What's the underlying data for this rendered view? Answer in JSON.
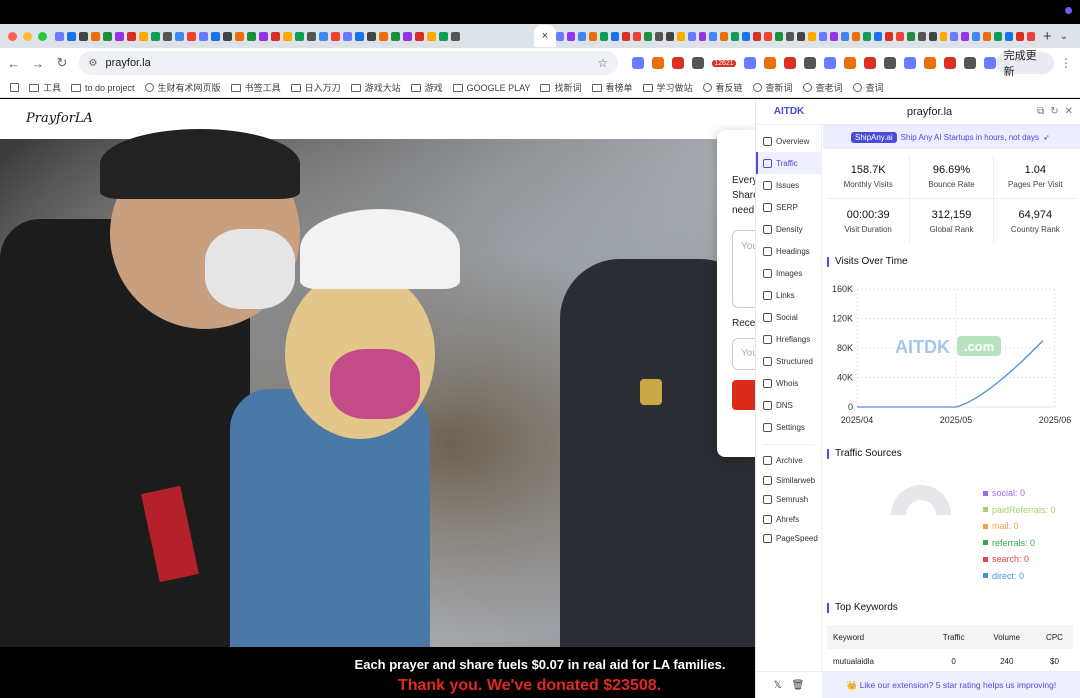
{
  "browser": {
    "active_tab_close": "×",
    "new_tab": "+",
    "tab_menu": "⌄",
    "url": "prayfor.la",
    "update_button": "完成更新",
    "bookmarks": [
      {
        "icon": "apps-icon",
        "label": ""
      },
      {
        "icon": "folder-icon",
        "label": "工具"
      },
      {
        "icon": "folder-icon",
        "label": "to do project"
      },
      {
        "icon": "site-icon",
        "label": "生财有术网页版"
      },
      {
        "icon": "folder-icon",
        "label": "书签工具"
      },
      {
        "icon": "folder-icon",
        "label": "日入万刀"
      },
      {
        "icon": "folder-icon",
        "label": "游戏大站"
      },
      {
        "icon": "folder-icon",
        "label": "游戏"
      },
      {
        "icon": "folder-icon",
        "label": "GOOGLE PLAY"
      },
      {
        "icon": "folder-icon",
        "label": "找新词"
      },
      {
        "icon": "folder-icon",
        "label": "看榜单"
      },
      {
        "icon": "folder-icon",
        "label": "学习做站"
      },
      {
        "icon": "site-icon",
        "label": "看反链"
      },
      {
        "icon": "site-icon",
        "label": "查新词"
      },
      {
        "icon": "site-icon",
        "label": "查老词"
      },
      {
        "icon": "site-icon",
        "label": "查词"
      }
    ],
    "ext_badge": "12621"
  },
  "page": {
    "logo": "PrayforLA",
    "card": {
      "line1": "Every",
      "line2": "Share",
      "line3": "need",
      "textarea_placeholder": "You",
      "label": "Recei",
      "input_placeholder": "You"
    },
    "footer_line1": "Each prayer and share fuels $0.07 in real aid for LA families.",
    "footer_line2": "Thank you. We've donated  $23508."
  },
  "panel": {
    "brand": "AITDK",
    "site": "prayfor.la",
    "nav": [
      {
        "label": "Overview",
        "icon": "overview-icon",
        "active": false
      },
      {
        "label": "Traffic",
        "icon": "traffic-icon",
        "active": true
      },
      {
        "label": "Issues",
        "icon": "warning-icon",
        "active": false
      },
      {
        "label": "SERP",
        "icon": "serp-icon",
        "active": false
      },
      {
        "label": "Density",
        "icon": "density-icon",
        "active": false
      },
      {
        "label": "Headings",
        "icon": "headings-icon",
        "active": false
      },
      {
        "label": "Images",
        "icon": "image-icon",
        "active": false
      },
      {
        "label": "Links",
        "icon": "link-icon",
        "active": false
      },
      {
        "label": "Social",
        "icon": "social-icon",
        "active": false
      },
      {
        "label": "Hreflangs",
        "icon": "globe-icon",
        "active": false
      },
      {
        "label": "Structured",
        "icon": "braces-icon",
        "active": false
      },
      {
        "label": "Whois",
        "icon": "whois-icon",
        "active": false
      },
      {
        "label": "DNS",
        "icon": "dns-icon",
        "active": false
      },
      {
        "label": "Settings",
        "icon": "gear-icon",
        "active": false
      }
    ],
    "external": [
      {
        "label": "Archive",
        "icon": "archive-icon"
      },
      {
        "label": "Similarweb",
        "icon": "similarweb-icon"
      },
      {
        "label": "Semrush",
        "icon": "semrush-icon"
      },
      {
        "label": "Ahrefs",
        "icon": "ahrefs-icon"
      },
      {
        "label": "PageSpeed",
        "icon": "pagespeed-icon"
      }
    ],
    "promo_tag": "ShipAny.ai",
    "promo_text": "Ship Any AI Startups in hours, not days",
    "stats": [
      {
        "value": "158.7K",
        "label": "Monthly Visits"
      },
      {
        "value": "96.69%",
        "label": "Bounce Rate"
      },
      {
        "value": "1.04",
        "label": "Pages Per Visit"
      },
      {
        "value": "00:00:39",
        "label": "Visit Duration"
      },
      {
        "value": "312,159",
        "label": "Global Rank"
      },
      {
        "value": "64,974",
        "label": "Country Rank"
      }
    ],
    "visits_title": "Visits Over Time",
    "sources_title": "Traffic Sources",
    "keywords_title": "Top Keywords",
    "watermark_text": "AITDK",
    "watermark_badge": ".com",
    "sources": [
      {
        "label": "social: 0",
        "color": "#9b6cf0"
      },
      {
        "label": "paidReferrals: 0",
        "color": "#a8d16a"
      },
      {
        "label": "mail: 0",
        "color": "#f0a146"
      },
      {
        "label": "referrals: 0",
        "color": "#3aa748"
      },
      {
        "label": "search: 0",
        "color": "#e64545"
      },
      {
        "label": "direct: 0",
        "color": "#4a90e2"
      }
    ],
    "keywords": {
      "headers": [
        "Keyword",
        "Traffic",
        "Volume",
        "CPC"
      ],
      "rows": [
        [
          "mutualaidla",
          "0",
          "240",
          "$0"
        ]
      ]
    },
    "footer_rating": "👑 Like our extension? 5 star rating helps us improving!"
  },
  "chart_data": {
    "type": "line",
    "title": "Visits Over Time",
    "x": [
      "2025/04",
      "2025/05",
      "2025/06"
    ],
    "series": [
      {
        "values": [
          0,
          0,
          90000
        ]
      }
    ],
    "ylim": [
      0,
      160000
    ],
    "yticks": [
      "0",
      "40K",
      "80K",
      "120K",
      "160K"
    ],
    "ytick_values": [
      0,
      40000,
      80000,
      120000,
      160000
    ],
    "grid": true,
    "color": "#4a90e2"
  }
}
